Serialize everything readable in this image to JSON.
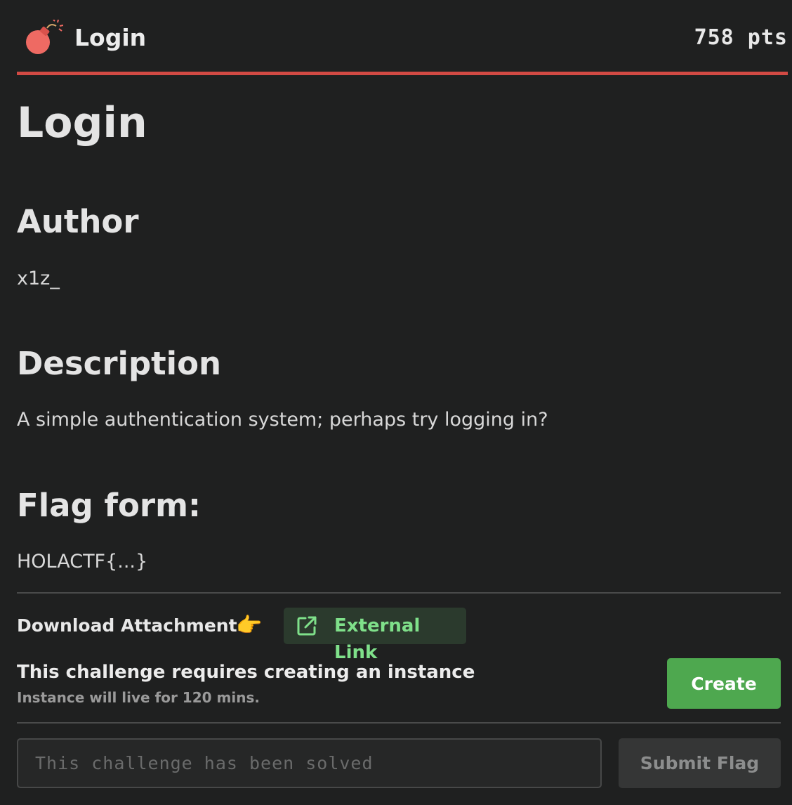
{
  "header": {
    "icon": "bomb-icon",
    "title": "Login",
    "points": "758 pts",
    "accent_color": "#d24a44"
  },
  "challenge": {
    "title": "Login",
    "author_heading": "Author",
    "author": "x1z_",
    "description_heading": "Description",
    "description": "A simple authentication system; perhaps try logging in?",
    "flag_form_heading": "Flag form:",
    "flag_form": "HOLACTF{...}"
  },
  "attachment": {
    "label": "Download Attachment",
    "pointer_icon": "pointing-hand-icon",
    "link_icon": "external-link-icon",
    "link_label": "External Link",
    "link_color": "#7fe08a"
  },
  "instance": {
    "title": "This challenge requires creating an instance",
    "subtitle": "Instance will live for 120 mins.",
    "create_label": "Create",
    "create_color": "#4ea84f"
  },
  "submit": {
    "placeholder": "This challenge has been solved",
    "button_label": "Submit Flag"
  }
}
